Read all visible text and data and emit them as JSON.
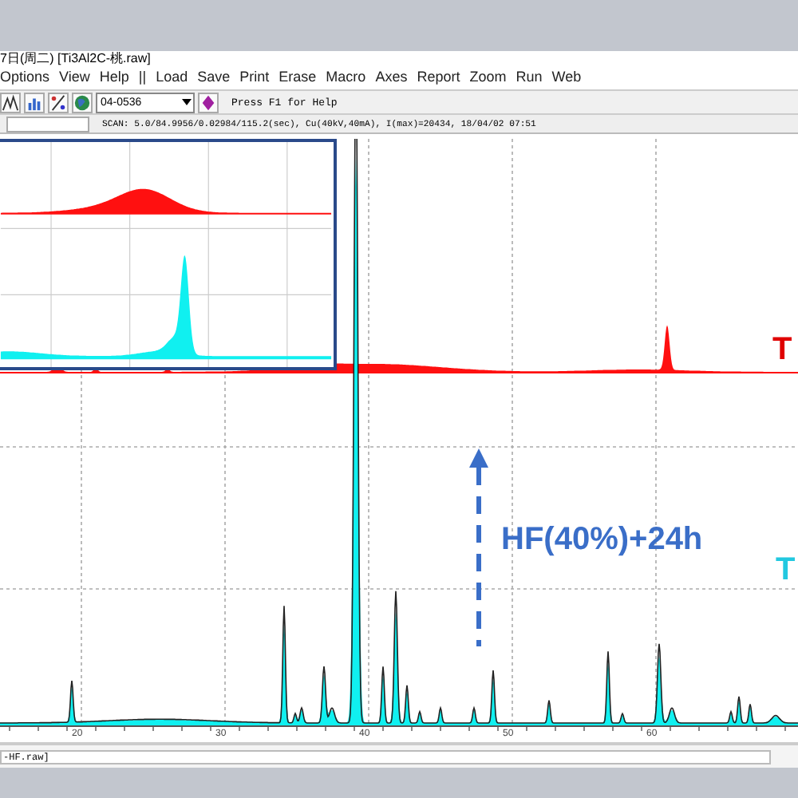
{
  "window": {
    "title": "7日(周二) [Ti3Al2C-桃.raw]"
  },
  "menu": [
    "Options",
    "View",
    "Help",
    "||",
    "Load",
    "Save",
    "Print",
    "Erase",
    "Macro",
    "Axes",
    "Report",
    "Zoom",
    "Run",
    "Web"
  ],
  "toolbar": {
    "pattern_id": "04-0536",
    "hint": "Press F1 for Help"
  },
  "scan_info": "SCAN: 5.0/84.9956/0.02984/115.2(sec), Cu(40kV,40mA), I(max)=20434, 18/04/02 07:51",
  "plot": {
    "x_ticks": [
      "20",
      "30",
      "40",
      "50",
      "60"
    ],
    "labels": [
      {
        "color": "#e00000",
        "text": "T"
      },
      {
        "color": "#22c8e0",
        "text": "T"
      }
    ],
    "annotation": "HF(40%)+24h"
  },
  "file_field": "-HF.raw]"
}
